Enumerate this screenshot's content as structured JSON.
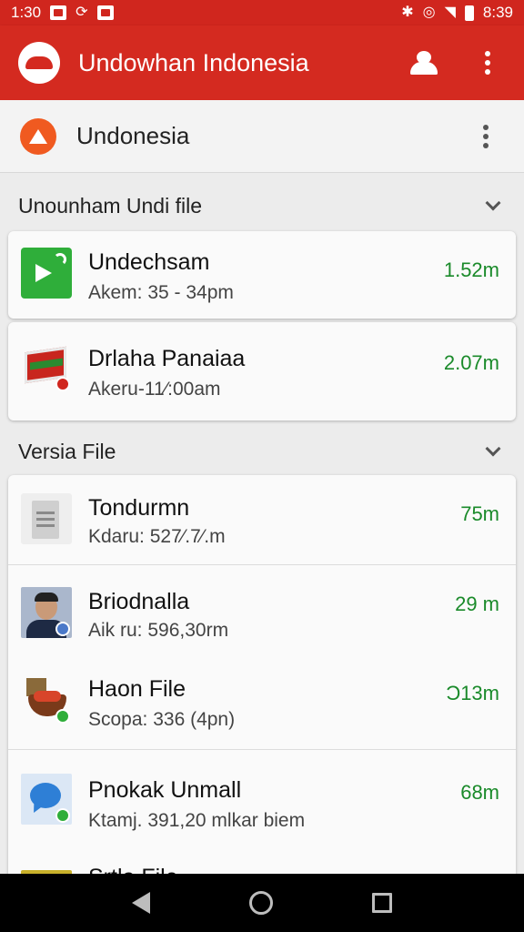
{
  "status_bar": {
    "time_left": "1:30",
    "time_right": "8:39"
  },
  "app_bar": {
    "title": "Undowhan Indonesia"
  },
  "account": {
    "name": "Undonesia"
  },
  "sections": [
    {
      "title": "Unounham Undi file",
      "items": [
        {
          "title": "Undechsam",
          "subtitle": "Akem: 35 - 34pm",
          "size": "1.52m",
          "icon": "green-play-icon"
        },
        {
          "title": "Drlaha Panaiaa",
          "subtitle": "Akeru-11⁄:00am",
          "size": "2.07m",
          "icon": "red-flag-badge-icon"
        }
      ]
    },
    {
      "title": "Versia File",
      "items": [
        {
          "title": "Tondurmn",
          "subtitle": "Kdaru: 527⁄.7⁄.m",
          "size": "75m",
          "icon": "document-icon"
        },
        {
          "title": "Briodnalla",
          "subtitle": "Aik ru: 596,30rm",
          "size": "29 m",
          "icon": "avatar-photo"
        },
        {
          "title": "Haon File",
          "subtitle": "Scopa: 336 (4pn)",
          "size": "Ɔ13m",
          "icon": "food-basket-icon"
        },
        {
          "title": "Pnokak Unmall",
          "subtitle": "Ktamj. 391,20 mlkar biem",
          "size": "68m",
          "icon": "chat-bubble-icon"
        },
        {
          "title": "Srtla File",
          "subtitle": "",
          "size": "",
          "icon": "folder-icon"
        }
      ]
    }
  ],
  "colors": {
    "app_bar": "#d42a20",
    "size_text": "#1a8a2a",
    "account_icon": "#f05a20"
  }
}
